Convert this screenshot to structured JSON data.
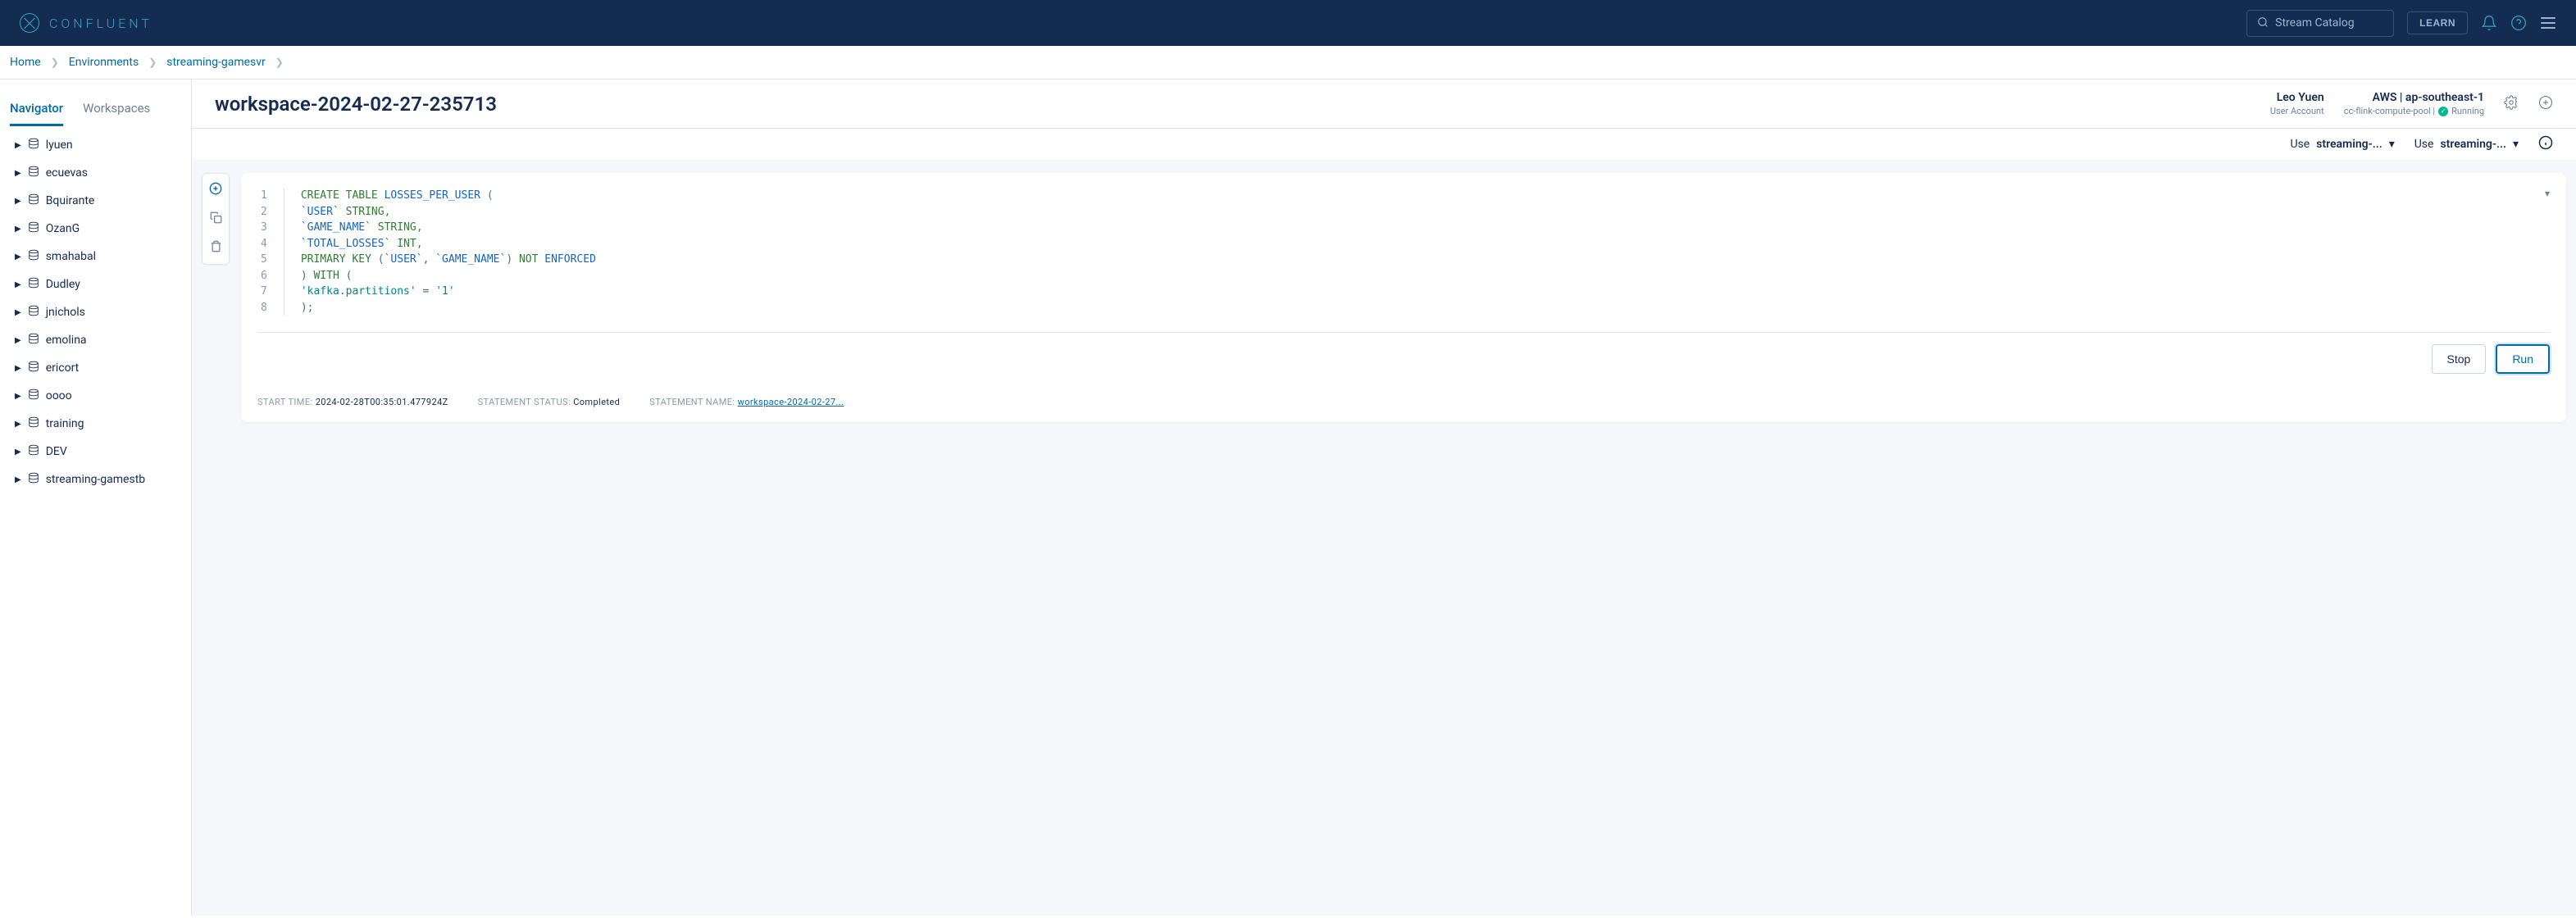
{
  "header": {
    "brand": "CONFLUENT",
    "search_placeholder": "Stream Catalog",
    "learn_label": "LEARN"
  },
  "breadcrumbs": {
    "items": [
      "Home",
      "Environments",
      "streaming-gamesvr"
    ]
  },
  "sidebar": {
    "tabs": {
      "navigator": "Navigator",
      "workspaces": "Workspaces"
    },
    "tree_items": [
      "lyuen",
      "ecuevas",
      "Bquirante",
      "OzanG",
      "smahabal",
      "Dudley",
      "jnichols",
      "emolina",
      "ericort",
      "oooo",
      "training",
      "DEV",
      "streaming-gamestb"
    ]
  },
  "content": {
    "title": "workspace-2024-02-27-235713",
    "user": {
      "name": "Leo Yuen",
      "role": "User Account"
    },
    "region": {
      "title": "AWS | ap-southeast-1",
      "pool": "cc-flink-compute-pool |",
      "status": "Running"
    },
    "use1": {
      "prefix": "Use",
      "val": "streaming-..."
    },
    "use2": {
      "prefix": "Use",
      "val": "streaming-..."
    }
  },
  "editor": {
    "code_tokens": [
      [
        {
          "t": "CREATE",
          "c": "kw"
        },
        {
          "t": " ",
          "c": ""
        },
        {
          "t": "TABLE",
          "c": "kw"
        },
        {
          "t": " ",
          "c": ""
        },
        {
          "t": "LOSSES_PER_USER",
          "c": "id"
        },
        {
          "t": " (",
          "c": "punc"
        }
      ],
      [
        {
          "t": "    `USER`",
          "c": "id"
        },
        {
          "t": " ",
          "c": ""
        },
        {
          "t": "STRING",
          "c": "kw"
        },
        {
          "t": ",",
          "c": "punc"
        }
      ],
      [
        {
          "t": "    `GAME_NAME`",
          "c": "id"
        },
        {
          "t": " ",
          "c": ""
        },
        {
          "t": "STRING",
          "c": "kw"
        },
        {
          "t": ",",
          "c": "punc"
        }
      ],
      [
        {
          "t": "    `TOTAL_LOSSES`",
          "c": "id"
        },
        {
          "t": " ",
          "c": ""
        },
        {
          "t": "INT",
          "c": "kw"
        },
        {
          "t": ",",
          "c": "punc"
        }
      ],
      [
        {
          "t": "    ",
          "c": ""
        },
        {
          "t": "PRIMARY",
          "c": "kw"
        },
        {
          "t": " ",
          "c": ""
        },
        {
          "t": "KEY",
          "c": "kw"
        },
        {
          "t": " (",
          "c": "punc"
        },
        {
          "t": "`USER`",
          "c": "id"
        },
        {
          "t": ", ",
          "c": "punc"
        },
        {
          "t": "`GAME_NAME`",
          "c": "id"
        },
        {
          "t": ") ",
          "c": "punc"
        },
        {
          "t": "NOT",
          "c": "kw"
        },
        {
          "t": " ",
          "c": ""
        },
        {
          "t": "ENFORCED",
          "c": "id"
        }
      ],
      [
        {
          "t": ") ",
          "c": "punc"
        },
        {
          "t": "WITH",
          "c": "kw"
        },
        {
          "t": " (",
          "c": "punc"
        }
      ],
      [
        {
          "t": "    ",
          "c": ""
        },
        {
          "t": "'kafka.partitions'",
          "c": "str"
        },
        {
          "t": " = ",
          "c": "punc"
        },
        {
          "t": "'1'",
          "c": "str"
        }
      ],
      [
        {
          "t": ");",
          "c": "punc"
        }
      ]
    ],
    "actions": {
      "stop": "Stop",
      "run": "Run"
    },
    "footer": {
      "start_label": "START TIME:",
      "start_val": "2024-02-28T00:35:01.477924Z",
      "status_label": "STATEMENT STATUS:",
      "status_val": "Completed",
      "name_label": "STATEMENT NAME:",
      "name_val": "workspace-2024-02-27..."
    }
  }
}
